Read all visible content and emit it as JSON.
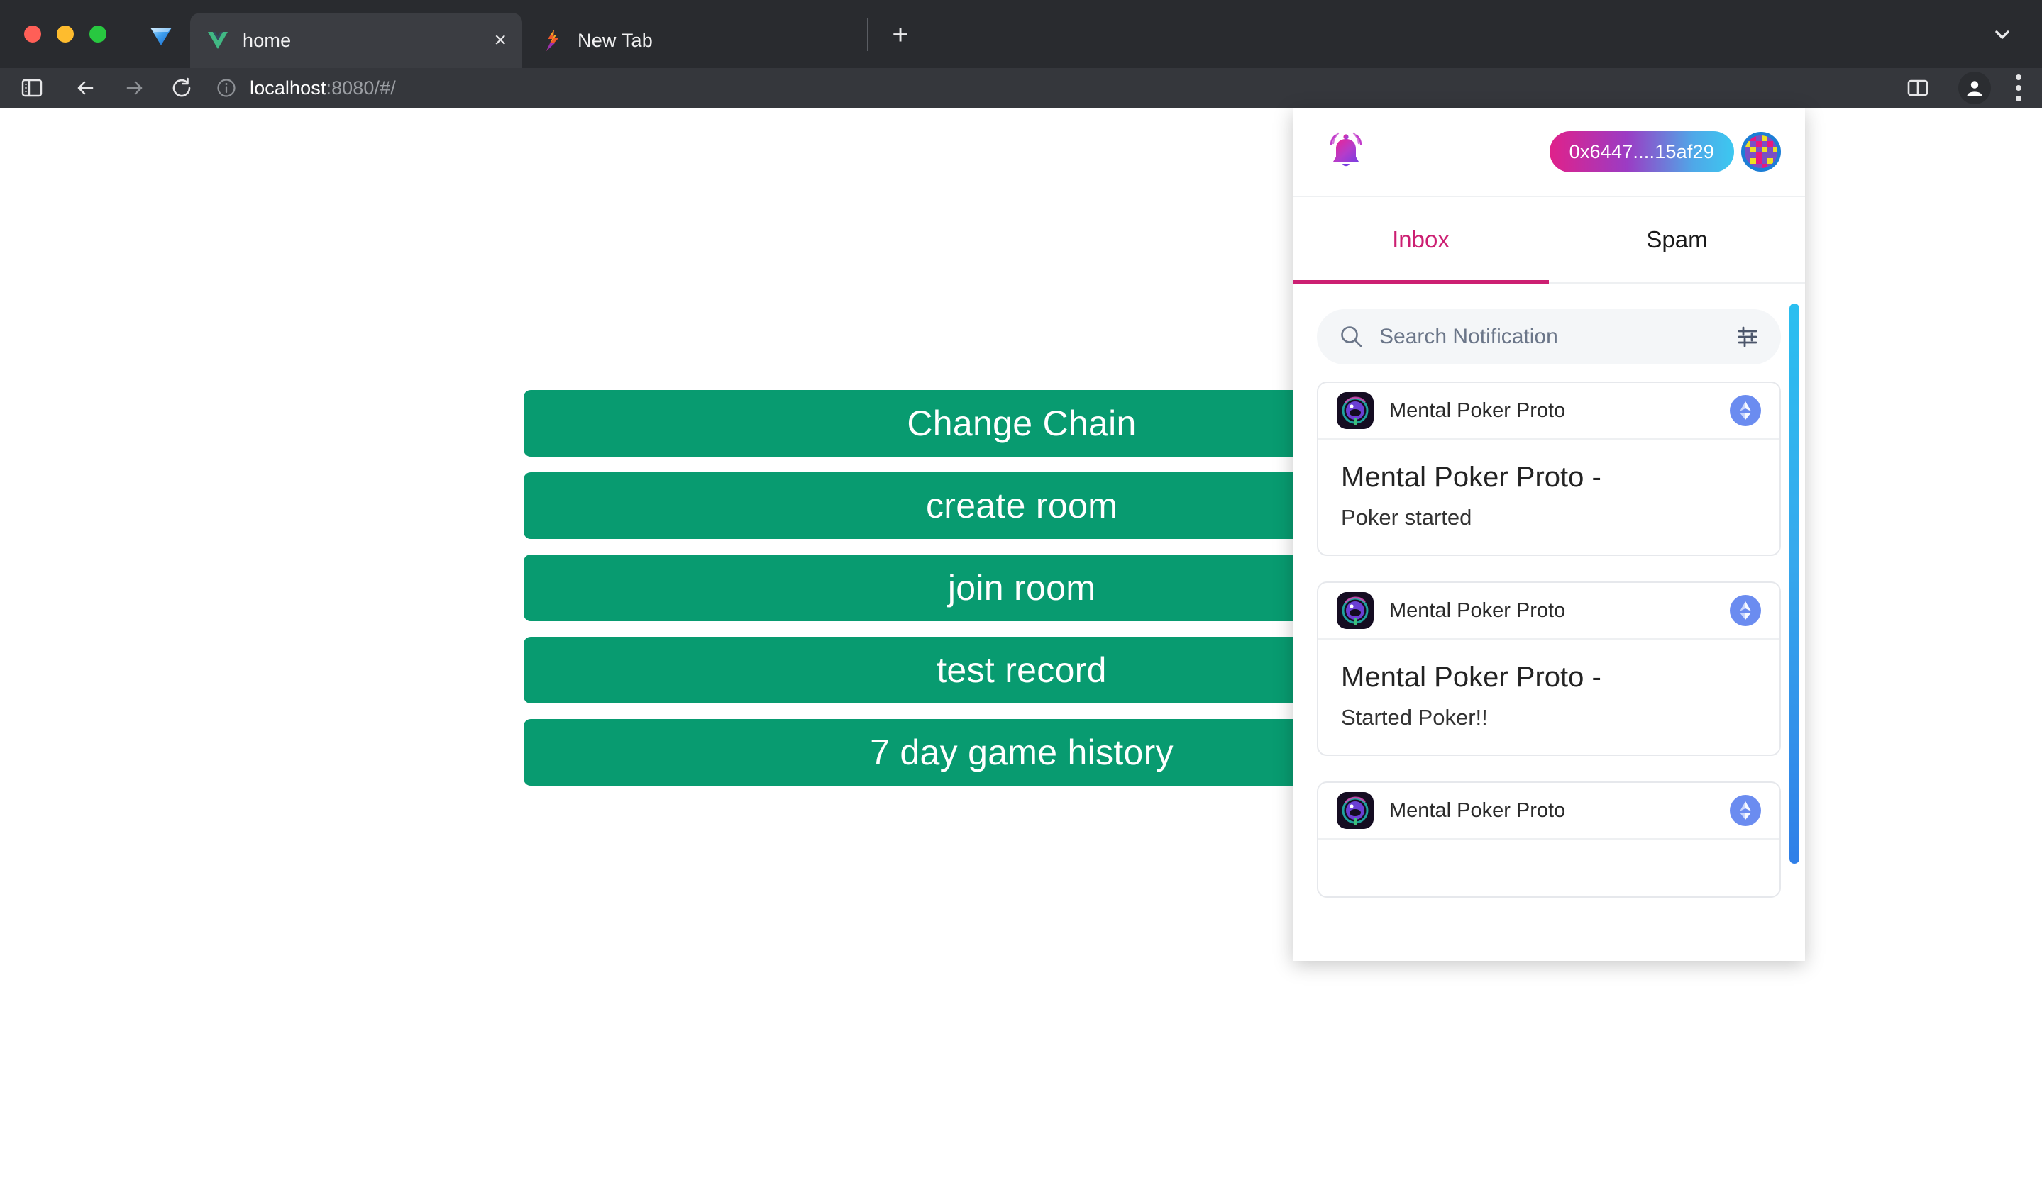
{
  "browser": {
    "window_controls": [
      "close",
      "minimize",
      "maximize"
    ],
    "app_icon": "diamond-icon",
    "tabs": [
      {
        "title": "home",
        "favicon": "vue-logo-icon",
        "active": true,
        "close_label": "×"
      },
      {
        "title": "New Tab",
        "favicon": "lightning-s-icon",
        "active": false,
        "close_label": ""
      }
    ],
    "new_tab_label": "+",
    "tab_list_chevron": "chevron-down-icon",
    "toolbar": {
      "sidebar_icon": "sidebar-toggle-icon",
      "back_icon": "back-arrow-icon",
      "forward_icon": "forward-arrow-icon",
      "reload_icon": "reload-icon",
      "info_icon": "info-circle-icon",
      "url_host": "localhost",
      "url_rest": ":8080/#/",
      "split_view_icon": "split-view-icon",
      "profile_icon": "profile-avatar-icon",
      "menu_icon": "kebab-menu-icon"
    }
  },
  "page": {
    "buttons": [
      {
        "label": "Change Chain"
      },
      {
        "label": "create room"
      },
      {
        "label": "join room"
      },
      {
        "label": "test record"
      },
      {
        "label": "7 day game history"
      }
    ],
    "button_color": "#089b70",
    "button_text_color": "#ffffff"
  },
  "notification_panel": {
    "bell_icon": "notification-bell-icon",
    "wallet_address": "0x6447....15af29",
    "wallet_pill_gradient_from": "#e0218a",
    "wallet_pill_gradient_to": "#3cc8f0",
    "avatar_icon": "wallet-identicon",
    "avatar_ring_color": "#1c7ed6",
    "tabs": [
      {
        "label": "Inbox",
        "active": true
      },
      {
        "label": "Spam",
        "active": false
      }
    ],
    "active_tab_color": "#cc1f72",
    "search": {
      "placeholder": "Search Notification",
      "value": "",
      "icon": "search-icon",
      "filter_icon": "filter-sliders-icon"
    },
    "notifications": [
      {
        "app_name": "Mental Poker Proto",
        "app_icon": "mental-poker-app-icon",
        "chain_icon": "ethereum-icon",
        "title": "Mental Poker Proto -",
        "subtitle": "Poker started"
      },
      {
        "app_name": "Mental Poker Proto",
        "app_icon": "mental-poker-app-icon",
        "chain_icon": "ethereum-icon",
        "title": "Mental Poker Proto -",
        "subtitle": "Started Poker!!"
      },
      {
        "app_name": "Mental Poker Proto",
        "app_icon": "mental-poker-app-icon",
        "chain_icon": "ethereum-icon",
        "title": "",
        "subtitle": ""
      }
    ],
    "scrollbar": {
      "gradient_from": "#2bbff0",
      "gradient_to": "#2f7fe8"
    }
  }
}
